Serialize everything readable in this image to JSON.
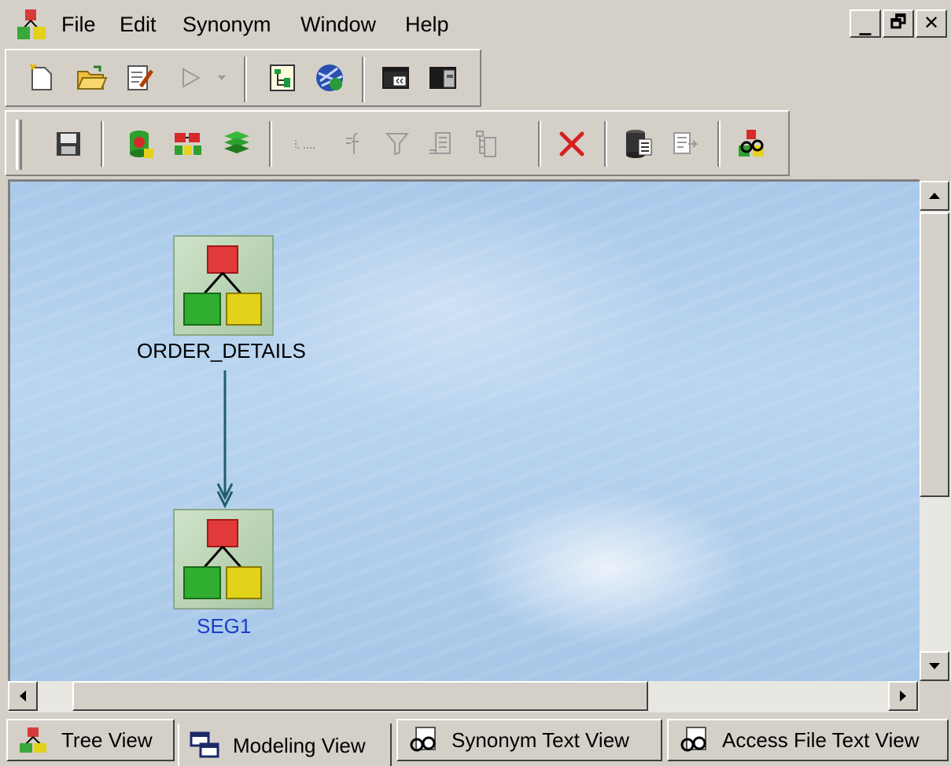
{
  "menubar": {
    "items": [
      "File",
      "Edit",
      "Synonym",
      "Window",
      "Help"
    ],
    "window_controls": {
      "minimize": "_",
      "restore": "🗗",
      "close": "✕"
    }
  },
  "toolbar1": {
    "buttons": [
      {
        "icon": "new-icon"
      },
      {
        "icon": "open-folder-icon"
      },
      {
        "icon": "edit-icon"
      },
      {
        "icon": "run-icon"
      },
      {
        "icon": "dropdown-arrow-icon"
      },
      {
        "icon": "tree-view-icon"
      },
      {
        "icon": "globe-icon"
      },
      {
        "icon": "window-icon"
      },
      {
        "icon": "window-split-icon"
      }
    ]
  },
  "toolbar2": {
    "buttons": [
      {
        "icon": "save-icon"
      },
      {
        "icon": "segment-insert-icon"
      },
      {
        "icon": "segment-copy-icon"
      },
      {
        "icon": "segment-stack-icon"
      },
      {
        "icon": "field-icon"
      },
      {
        "icon": "function-icon"
      },
      {
        "icon": "filter-icon"
      },
      {
        "icon": "calc-field-icon"
      },
      {
        "icon": "tree-list-icon"
      },
      {
        "icon": "delete-icon"
      },
      {
        "icon": "database-icon"
      },
      {
        "icon": "export-icon"
      },
      {
        "icon": "view-icon"
      }
    ]
  },
  "canvas": {
    "nodes": [
      {
        "label": "ORDER_DETAILS",
        "label_color": "#000000"
      },
      {
        "label": "SEG1",
        "label_color": "#1a3ec8"
      }
    ]
  },
  "tabs": [
    {
      "label": "Tree View",
      "icon": "tree-view-icon",
      "active": false
    },
    {
      "label": "Modeling View",
      "icon": "modeling-view-icon",
      "active": true
    },
    {
      "label": "Synonym Text View",
      "icon": "glasses-icon",
      "active": false
    },
    {
      "label": "Access File Text View",
      "icon": "glasses-icon",
      "active": false
    }
  ],
  "colors": {
    "canvas_bg": "#b3d1ee",
    "connector": "#1f5f6a",
    "chrome": "#d4d0c8"
  }
}
